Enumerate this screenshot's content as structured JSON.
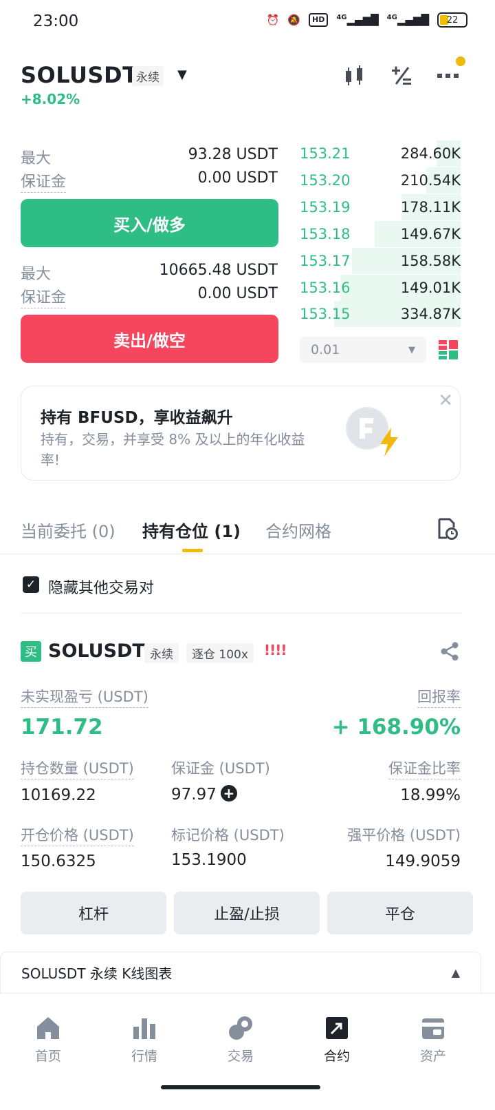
{
  "status_bar": {
    "time": "23:00",
    "hd": "HD",
    "net1": "4G",
    "net2": "4G",
    "battery": "22"
  },
  "header": {
    "symbol": "SOLUSDT",
    "contract_type": "永续",
    "change_pct": "+8.02%"
  },
  "trade": {
    "buy_max_label": "最大",
    "buy_max_value": "93.28 USDT",
    "buy_margin_label": "保证金",
    "buy_margin_value": "0.00 USDT",
    "buy_button": "买入/做多",
    "sell_max_label": "最大",
    "sell_max_value": "10665.48 USDT",
    "sell_margin_label": "保证金",
    "sell_margin_value": "0.00 USDT",
    "sell_button": "卖出/做空"
  },
  "order_book": {
    "bids": [
      {
        "price": "153.21",
        "qty": "284.60K",
        "depth": 0.19
      },
      {
        "price": "153.20",
        "qty": "210.54K",
        "depth": 0.27
      },
      {
        "price": "153.19",
        "qty": "178.11K",
        "depth": 0.47
      },
      {
        "price": "153.18",
        "qty": "149.67K",
        "depth": 0.68
      },
      {
        "price": "153.17",
        "qty": "158.58K",
        "depth": 0.86
      },
      {
        "price": "153.16",
        "qty": "149.01K",
        "depth": 0.95
      },
      {
        "price": "153.15",
        "qty": "334.87K",
        "depth": 1.0
      }
    ],
    "precision": "0.01"
  },
  "promo": {
    "title": "持有 BFUSD，享收益飙升",
    "subtitle": "持有，交易，并享受 8% 及以上的年化收益率!"
  },
  "tabs": {
    "open_orders": "当前委托 (0)",
    "positions": "持有仓位 (1)",
    "grid": "合约网格"
  },
  "filter": {
    "hide_others": "隐藏其他交易对"
  },
  "position": {
    "side_badge": "买",
    "symbol": "SOLUSDT",
    "contract_type": "永续",
    "margin_mode": "逐仓 100x",
    "risk_marks": "!!!!",
    "pnl_label": "未实现盈亏 (USDT)",
    "pnl_value": "171.72",
    "roe_label": "回报率",
    "roe_value": "+ 168.90%",
    "size_label": "持仓数量 (USDT)",
    "size_value": "10169.22",
    "margin_label": "保证金 (USDT)",
    "margin_value": "97.97",
    "margin_ratio_label": "保证金比率",
    "margin_ratio_value": "18.99%",
    "entry_label": "开仓价格 (USDT)",
    "entry_value": "150.6325",
    "mark_label": "标记价格 (USDT)",
    "mark_value": "153.1900",
    "liq_label": "强平价格 (USDT)",
    "liq_value": "149.9059",
    "btn_leverage": "杠杆",
    "btn_tpsl": "止盈/止损",
    "btn_close": "平仓"
  },
  "kline": {
    "label": "SOLUSDT 永续 K线图表"
  },
  "nav": {
    "home": "首页",
    "markets": "行情",
    "trade": "交易",
    "futures": "合约",
    "assets": "资产"
  },
  "colors": {
    "green": "#2ebd85",
    "red": "#f6465d",
    "accent": "#f0b90b"
  }
}
